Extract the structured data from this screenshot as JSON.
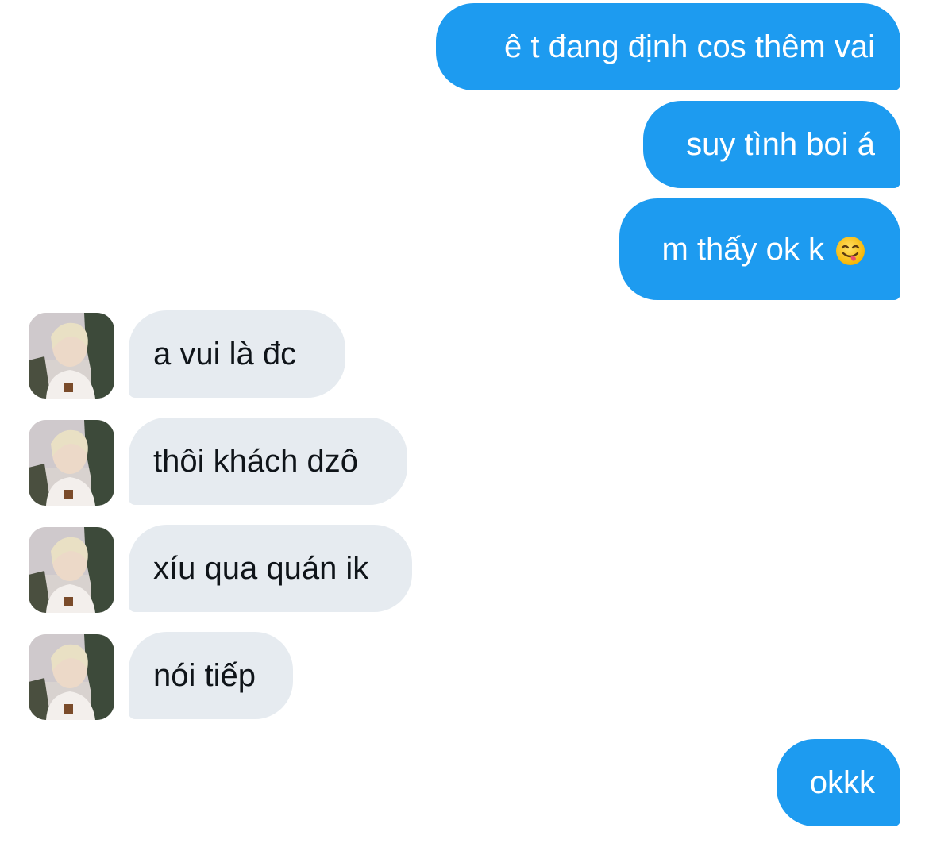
{
  "messages": [
    {
      "side": "out",
      "text": "ê t đang định cos thêm vai"
    },
    {
      "side": "out",
      "text": "suy tình boi á"
    },
    {
      "side": "out",
      "text": "m thấy ok k",
      "emoji": "face-savoring-food-emoji"
    },
    {
      "side": "in",
      "text": "a vui là đc"
    },
    {
      "side": "in",
      "text": "thôi khách dzô"
    },
    {
      "side": "in",
      "text": "xíu qua quán ik"
    },
    {
      "side": "in",
      "text": "nói tiếp"
    },
    {
      "side": "out",
      "text": "okkk"
    }
  ],
  "colors": {
    "outgoing_bubble": "#1d9bf0",
    "incoming_bubble": "#e6ebf0",
    "outgoing_text": "#ffffff",
    "incoming_text": "#0f1419"
  }
}
